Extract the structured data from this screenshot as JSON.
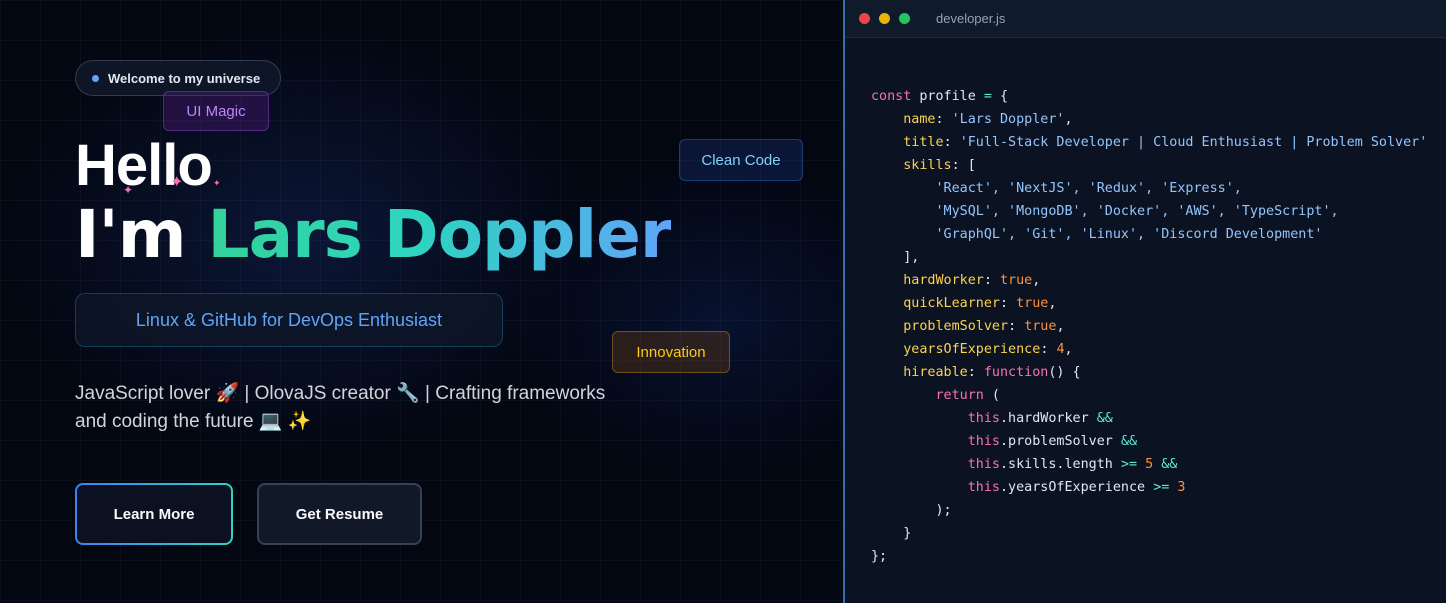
{
  "hero": {
    "welcome": "Welcome to my universe",
    "chips": {
      "magic": "UI Magic",
      "clean": "Clean Code",
      "innovation": "Innovation"
    },
    "hello": "Hello",
    "im": "I'm ",
    "name": "Lars Doppler",
    "tagline": "Linux & GitHub for DevOps Enthusiast",
    "desc_line1": "JavaScript lover 🚀 | OlovaJS creator 🔧 | Crafting frameworks",
    "desc_line2": "and coding the future 💻 ✨",
    "learn_more": "Learn More",
    "get_resume": "Get Resume"
  },
  "editor": {
    "filename": "developer.js",
    "profile": {
      "name": "'Lars Doppler'",
      "title": "'Full-Stack Developer | Cloud Enthusiast | Problem Solver'",
      "skills_row1": "'React', 'NextJS', 'Redux', 'Express',",
      "skills_row2": "'MySQL', 'MongoDB', 'Docker', 'AWS', 'TypeScript',",
      "skills_row3": "'GraphQL', 'Git', 'Linux', 'Discord Development'",
      "yearsOfExperience": "4",
      "min_skills": "5",
      "min_years": "3"
    }
  },
  "colors": {
    "accent_green": "#34d399",
    "accent_blue": "#60a5fa",
    "editor_border": "#3b6fb3"
  }
}
